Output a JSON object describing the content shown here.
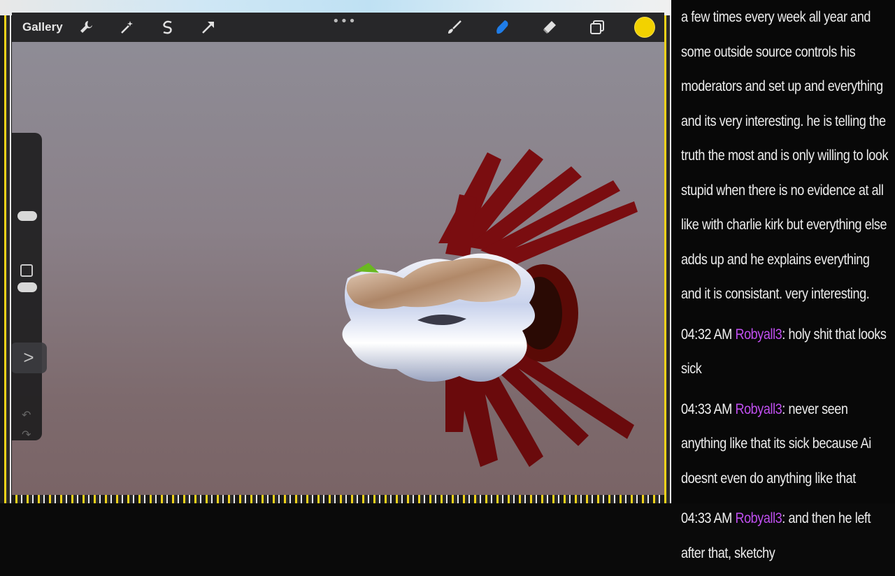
{
  "toolbar": {
    "gallery_label": "Gallery",
    "left_tools": [
      "wrench-icon",
      "magic-wand-icon",
      "selection-icon",
      "transform-arrow-icon"
    ],
    "right_tools": [
      "brush-icon",
      "smudge-icon",
      "eraser-icon",
      "layers-icon"
    ],
    "more_dots": "•••",
    "active_color": "#f2d200"
  },
  "sidebar": {
    "expand_glyph": ">",
    "undo_glyph": "↶",
    "redo_glyph": "↷"
  },
  "chat": {
    "partial_message": "a few times every week all year and some outside source controls his moderators and set up and everything and its very interesting. he is telling the truth the most and is only willing to look stupid when there is no evidence at all like with charlie kirk but everything else adds up and he explains everything and it is consistant. very interesting.",
    "messages": [
      {
        "time": "04:32 AM",
        "user": "Robyall3",
        "text": ": holy shit that looks sick"
      },
      {
        "time": "04:33 AM",
        "user": "Robyall3",
        "text": ": never seen anything like that its sick because Ai doesnt even do anything like that"
      },
      {
        "time": "04:33 AM",
        "user": "Robyall3",
        "text": ": and then he left after that, sketchy"
      }
    ],
    "username_color": "#c04ff0"
  }
}
